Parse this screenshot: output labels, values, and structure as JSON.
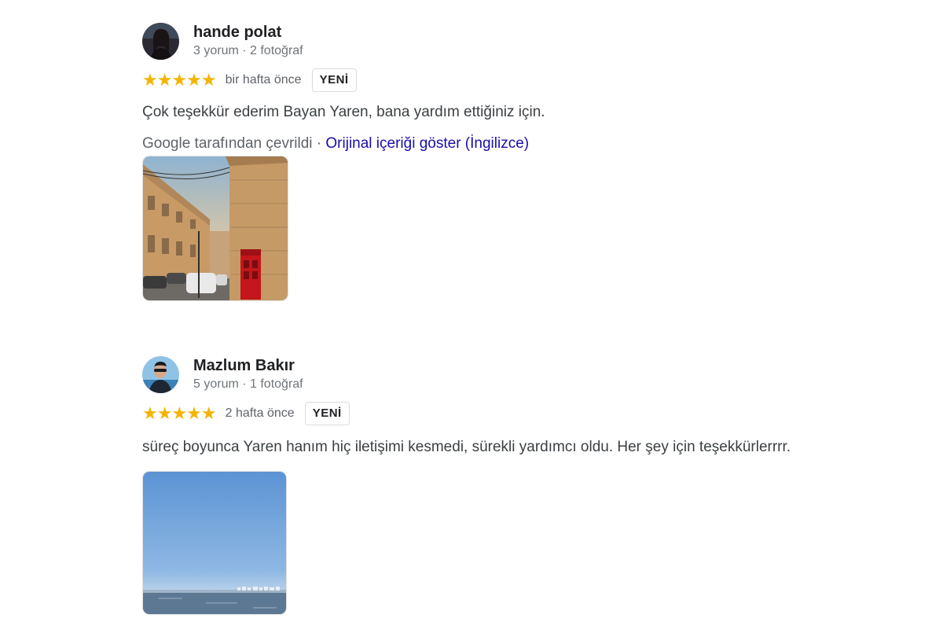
{
  "reviews": [
    {
      "name": "hande polat",
      "meta": "3 yorum · 2 fotoğraf",
      "stars": "★★★★★",
      "time_ago": "bir hafta önce",
      "badge": "YENİ",
      "text": "Çok teşekkür ederim Bayan Yaren, bana yardım ettiğiniz için.",
      "translated_label": "Google tarafından çevrildi",
      "separator": "·",
      "show_original": "Orijinal içeriği göster (İngilizce)"
    },
    {
      "name": "Mazlum Bakır",
      "meta": "5 yorum · 1 fotoğraf",
      "stars": "★★★★★",
      "time_ago": "2 hafta önce",
      "badge": "YENİ",
      "text": "süreç boyunca Yaren hanım hiç iletişimi kesmedi, sürekli yardımcı oldu. Her şey için teşekkürlerrrr."
    }
  ],
  "colors": {
    "star": "#f4b400",
    "link": "#1a0dab",
    "name": "#202124",
    "meta": "#70757a"
  }
}
